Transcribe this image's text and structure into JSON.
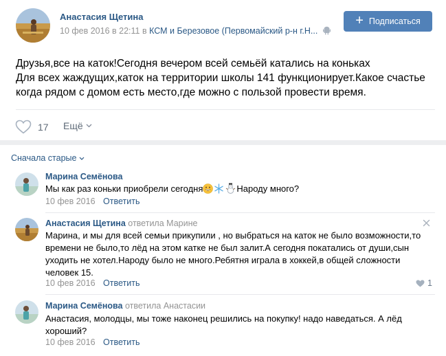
{
  "post": {
    "author": "Анастасия Щетина",
    "date": "10 фев 2016 в 22:11",
    "place_prefix": "в",
    "place": "КСМ и Березовое (Первомайский р-н г.Н...",
    "subscribe_label": "Подписаться",
    "text_lines": [
      "Друзья,все на каток!Сегодня вечером всей семьёй катались на коньках",
      "Для всех жаждущих,каток на территории школы 141 функционирует.Какое счастье",
      "когда рядом с домом есть место,где можно с пользой провести время."
    ],
    "likes": "17",
    "more_label": "Ещё"
  },
  "comments_sort_label": "Сначала старые",
  "comments": [
    {
      "author": "Марина Семёнова",
      "reply_to": "",
      "text_before": "Мы как раз коньки приобрели сегодня",
      "text_after": "Народу много?",
      "date": "10 фев 2016",
      "reply_label": "Ответить"
    },
    {
      "author": "Анастасия Щетина",
      "reply_to": "ответила Марине",
      "text_lines": [
        "Марина, и мы для всей семьи прикупили , но выбраться на каток не было возможности,то",
        "времени не было,то лёд на этом катке не был залит.А сегодня покатались от души,сын",
        "уходить не хотел.Народу было не много.Ребятня играла в хоккей,в общей сложности",
        "человек 15."
      ],
      "date": "10 фев 2016",
      "reply_label": "Ответить",
      "likes": "1"
    },
    {
      "author": "Марина Семёнова",
      "reply_to": "ответила Анастасии",
      "text_lines": [
        "Анастасия, молодцы, мы тоже наконец решились на покупку! надо наведаться. А лёд",
        "хороший?"
      ],
      "date": "10 фев 2016",
      "reply_label": "Ответить"
    }
  ],
  "icons": {
    "emoji_1": "grinning-face-emoji",
    "emoji_2": "snowflake-emoji",
    "emoji_3": "snowman-emoji"
  },
  "colors": {
    "link": "#2a5885",
    "button": "#5181b8",
    "muted": "#939393",
    "separator": "#edeef0"
  }
}
